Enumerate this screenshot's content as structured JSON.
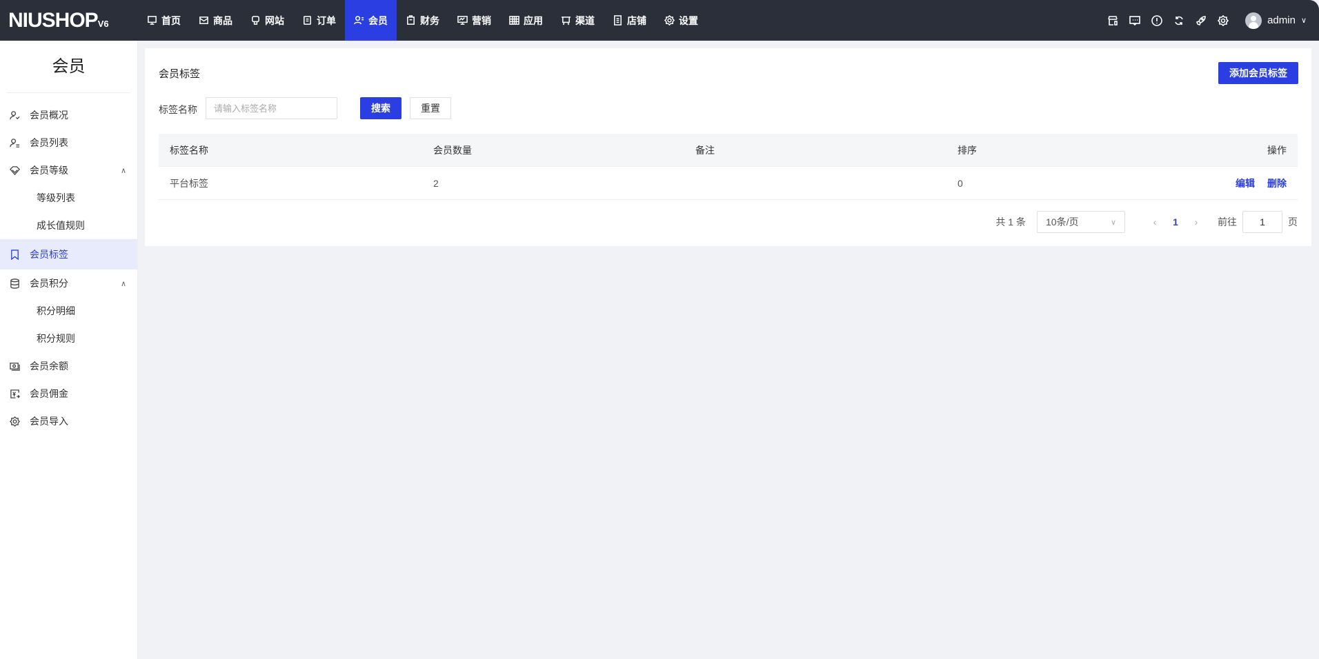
{
  "header": {
    "logo": "NIUSHOP",
    "logo_version": "V6",
    "nav": [
      {
        "label": "首页",
        "icon": "monitor-icon"
      },
      {
        "label": "商品",
        "icon": "box-icon"
      },
      {
        "label": "网站",
        "icon": "site-icon"
      },
      {
        "label": "订单",
        "icon": "clipboard-icon"
      },
      {
        "label": "会员",
        "icon": "member-icon",
        "active": true
      },
      {
        "label": "财务",
        "icon": "finance-icon"
      },
      {
        "label": "营销",
        "icon": "marketing-icon"
      },
      {
        "label": "应用",
        "icon": "app-icon"
      },
      {
        "label": "渠道",
        "icon": "channel-icon"
      },
      {
        "label": "店铺",
        "icon": "shop-icon"
      },
      {
        "label": "设置",
        "icon": "gear-icon"
      }
    ],
    "user": "admin"
  },
  "sidebar": {
    "title": "会员",
    "items": [
      {
        "label": "会员概况"
      },
      {
        "label": "会员列表"
      },
      {
        "label": "会员等级"
      },
      {
        "label": "等级列表"
      },
      {
        "label": "成长值规则"
      },
      {
        "label": "会员标签"
      },
      {
        "label": "会员积分"
      },
      {
        "label": "积分明细"
      },
      {
        "label": "积分规则"
      },
      {
        "label": "会员余额"
      },
      {
        "label": "会员佣金"
      },
      {
        "label": "会员导入"
      }
    ]
  },
  "main": {
    "title": "会员标签",
    "add_button": "添加会员标签",
    "search": {
      "label": "标签名称",
      "placeholder": "请输入标签名称",
      "search_button": "搜索",
      "reset_button": "重置"
    },
    "table": {
      "headers": [
        "标签名称",
        "会员数量",
        "备注",
        "排序",
        "操作"
      ],
      "rows": [
        {
          "name": "平台标签",
          "count": "2",
          "remark": "",
          "sort": "0",
          "actions": [
            "编辑",
            "删除"
          ]
        }
      ]
    },
    "pagination": {
      "total": "共 1 条",
      "page_size": "10条/页",
      "current": "1",
      "goto_label": "前往",
      "goto_value": "1",
      "page_suffix": "页"
    }
  },
  "colors": {
    "accent": "#2a3ee1",
    "header_bg": "#2b2f3a"
  }
}
